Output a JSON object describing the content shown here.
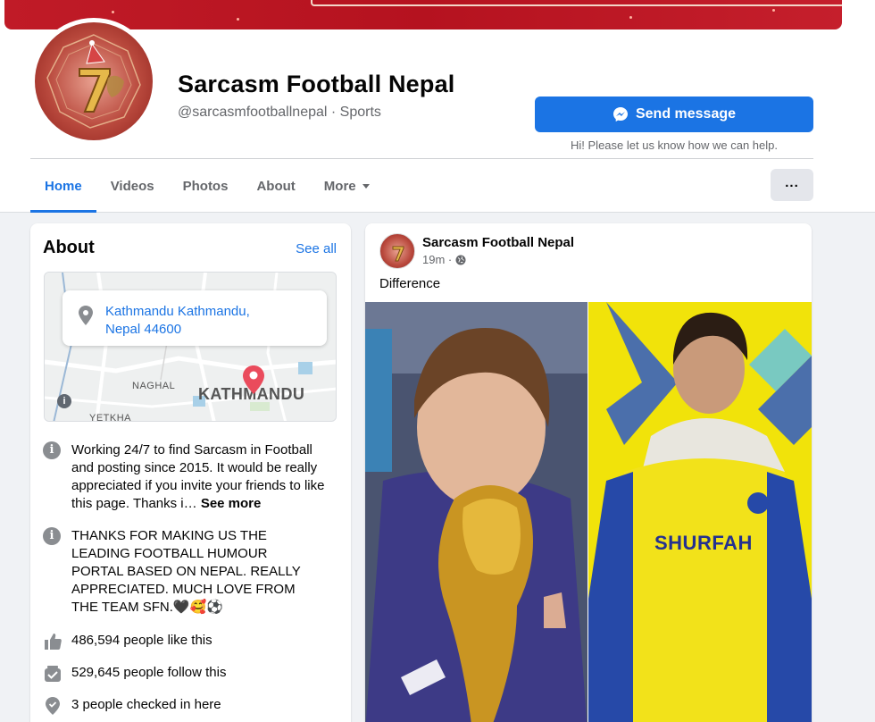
{
  "page": {
    "name": "Sarcasm Football Nepal",
    "handle": "@sarcasmfootballnepal · Sports"
  },
  "actions": {
    "send_message_label": "Send message",
    "help_text": "Hi! Please let us know how we can help."
  },
  "tabs": [
    {
      "label": "Home",
      "active": true
    },
    {
      "label": "Videos",
      "active": false
    },
    {
      "label": "Photos",
      "active": false
    },
    {
      "label": "About",
      "active": false
    },
    {
      "label": "More",
      "active": false
    }
  ],
  "more_button_label": "...",
  "about": {
    "title": "About",
    "see_all": "See all",
    "map": {
      "address_line1": "Kathmandu Kathmandu,",
      "address_line2": "Nepal 44600",
      "labels": [
        "NAGHAL",
        "KATHMANDU",
        "YETKHA"
      ]
    },
    "description": "Working 24/7 to find Sarcasm in Football and posting since 2015. It would be really appreciated if you invite your friends to like this page. Thanks i…",
    "see_more": "See more",
    "thanks_note": "THANKS FOR MAKING US THE LEADING FOOTBALL HUMOUR PORTAL BASED ON NEPAL. REALLY APPRECIATED. MUCH LOVE FROM THE TEAM SFN.🖤🥰⚽",
    "likes": "486,594 people like this",
    "follows": "529,645 people follow this",
    "checkins": "3 people checked in here"
  },
  "post": {
    "author": "Sarcasm Football Nepal",
    "time": "19m ·",
    "text": "Difference",
    "image_right_text": "SHURFAH"
  },
  "colors": {
    "accent": "#1b74e4",
    "secondary_text": "#65676b",
    "background": "#f0f2f5",
    "cover_red": "#c01b27"
  }
}
